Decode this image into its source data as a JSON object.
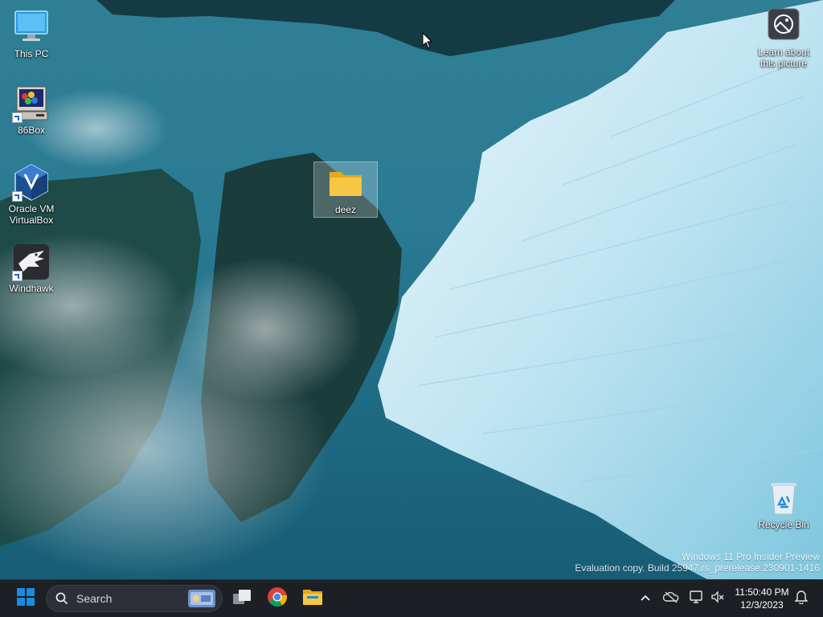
{
  "desktop": {
    "icons": [
      {
        "label": "This PC",
        "icon": "computer-icon"
      },
      {
        "label": "86Box",
        "icon": "86box-icon"
      },
      {
        "label": "Oracle VM VirtualBox",
        "icon": "virtualbox-icon"
      },
      {
        "label": "Windhawk",
        "icon": "windhawk-icon"
      },
      {
        "label": "deez",
        "icon": "folder-icon"
      },
      {
        "label": "Learn about this picture",
        "icon": "spotlight-icon"
      },
      {
        "label": "Recycle Bin",
        "icon": "recycle-bin-icon"
      }
    ],
    "watermark": {
      "line1": "Windows 11 Pro Insider Preview",
      "line2": "Evaluation copy. Build 25947.rs_prerelease.230901-1416"
    }
  },
  "taskbar": {
    "search_placeholder": "Search",
    "pinned": [
      "start-icon",
      "task-view-icon",
      "chrome-icon",
      "file-explorer-icon"
    ],
    "tray": [
      "chevron-up-icon",
      "onedrive-offline-icon",
      "network-icon",
      "volume-muted-icon",
      "notifications-icon"
    ],
    "time": "11:50:40 PM",
    "date": "12/3/2023"
  },
  "colors": {
    "taskbar_bg": "#1c1f24",
    "accent_blue": "#1a8ce0",
    "folder_yellow": "#f6c744"
  }
}
